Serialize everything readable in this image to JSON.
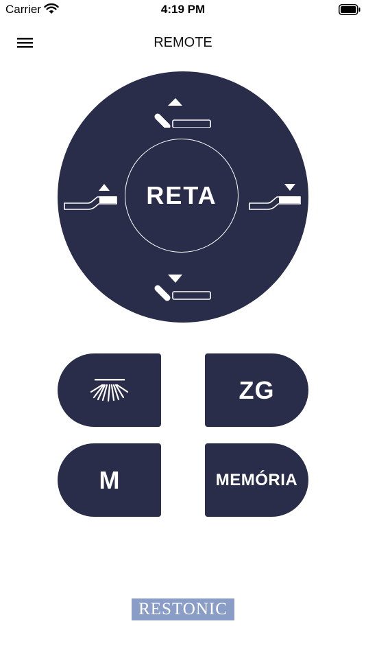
{
  "status_bar": {
    "carrier": "Carrier",
    "time": "4:19 PM"
  },
  "nav": {
    "title": "REMOTE",
    "menu_icon": "hamburger-menu-icon"
  },
  "dial": {
    "center_label": "RETA",
    "up_icon": "head-raise-up-icon",
    "down_icon": "head-lower-down-icon",
    "left_icon": "foot-raise-up-icon",
    "right_icon": "foot-lower-down-icon"
  },
  "buttons": {
    "light_icon": "under-bed-light-icon",
    "zg": "ZG",
    "m": "M",
    "memoria": "MEMÓRIA"
  },
  "logo": {
    "text": "RESTONIC"
  },
  "colors": {
    "primary": "#2a2d4a",
    "logo_bg": "#8a9dc6",
    "background": "#ffffff"
  }
}
